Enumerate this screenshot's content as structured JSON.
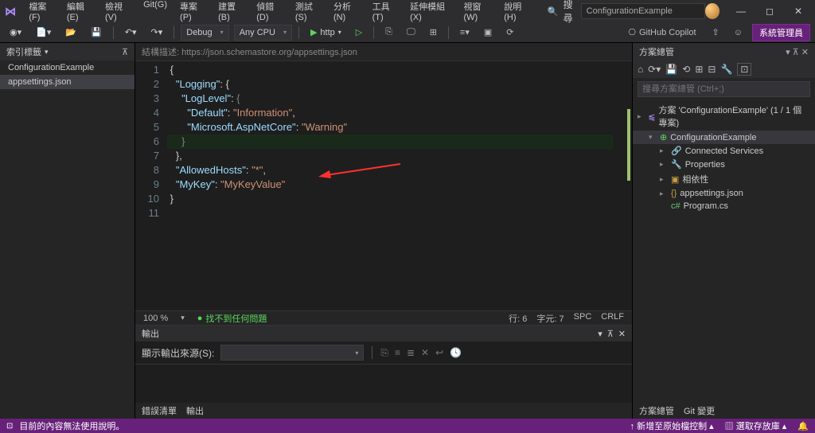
{
  "menu": {
    "file": "檔案(F)",
    "edit": "編輯(E)",
    "view": "檢視(V)",
    "git": "Git(G)",
    "project": "專案(P)",
    "build": "建置(B)",
    "debug": "偵錯(D)",
    "test": "測試(S)",
    "analyze": "分析(N)",
    "tools": "工具(T)",
    "extensions": "延伸模組(X)",
    "window": "視窗(W)",
    "help": "說明(H)"
  },
  "title_search_label": "搜尋",
  "title_search_value": "ConfigurationExample",
  "toolbar": {
    "config": "Debug",
    "platform": "Any CPU",
    "run": "http",
    "copilot": "GitHub Copilot",
    "admin": "系統管理員"
  },
  "left_pane": {
    "title": "索引標籤",
    "item1": "ConfigurationExample",
    "item2": "appsettings.json"
  },
  "schema": "結構描述: https://json.schemastore.org/appsettings.json",
  "code": {
    "l1": "{",
    "l2": "  \"Logging\": {",
    "l3": "    \"LogLevel\": {",
    "l4": "      \"Default\": \"Information\",",
    "l5": "      \"Microsoft.AspNetCore\": \"Warning\"",
    "l6": "    }",
    "l7": "  },",
    "l8": "  \"AllowedHosts\": \"*\",",
    "l9": "  \"MyKey\": \"MyKeyValue\"",
    "l10": "}"
  },
  "editor_status": {
    "zoom": "100 %",
    "issues": "找不到任何問題",
    "ln": "行: 6",
    "col": "字元: 7",
    "spc": "SPC",
    "eol": "CRLF"
  },
  "right_pane": {
    "title": "方案總管",
    "search_placeholder": "搜尋方案總管 (Ctrl+;)",
    "sln": "方案 'ConfigurationExample' (1 / 1 個專案)",
    "proj": "ConfigurationExample",
    "connected": "Connected Services",
    "props": "Properties",
    "deps": "相依性",
    "appsettings": "appsettings.json",
    "program": "Program.cs",
    "tab1": "方案總管",
    "tab2": "Git 變更"
  },
  "output": {
    "title": "輸出",
    "source_label": "顯示輸出來源(S):",
    "tab1": "錯誤清單",
    "tab2": "輸出"
  },
  "statusbar": {
    "msg": "目前的內容無法使用說明。",
    "src": "新增至原始檔控制",
    "repo": "選取存放庫"
  }
}
